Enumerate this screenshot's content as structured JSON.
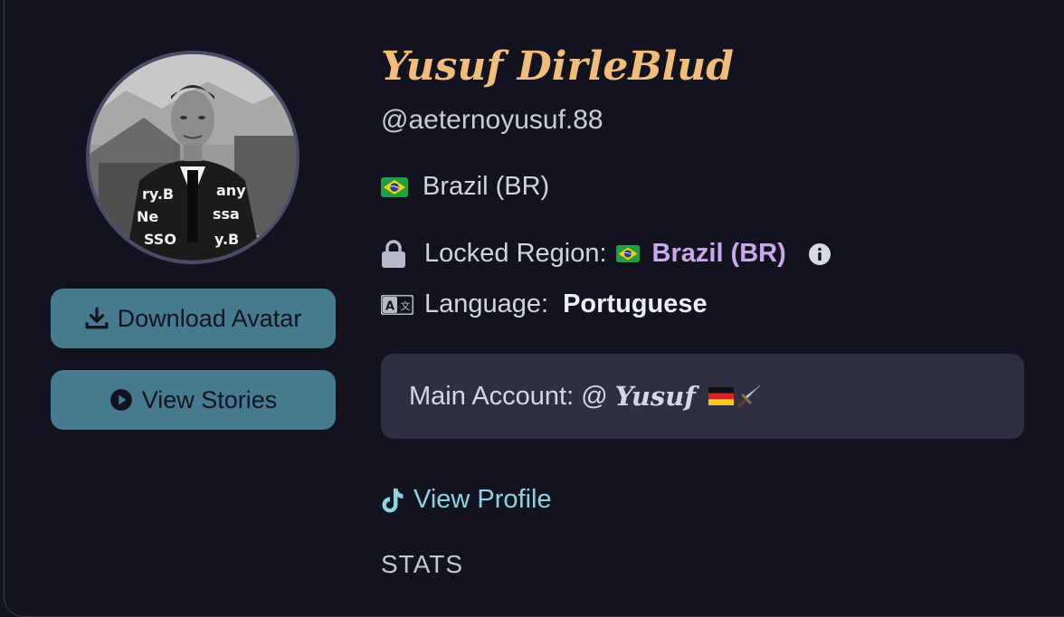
{
  "profile": {
    "display_name": "Yusuf DirleBlud",
    "handle": "@aeternoyusuf.88",
    "country": "Brazil (BR)",
    "locked_region_label": "Locked Region:",
    "locked_region_value": "Brazil (BR)",
    "language_label": "Language:",
    "language_value": "Portuguese",
    "main_account_label": "Main Account: @",
    "main_account_name": "Yusuf",
    "view_profile_label": "View Profile",
    "stats_label": "STATS"
  },
  "actions": {
    "download_avatar": "Download Avatar",
    "view_stories": "View Stories"
  },
  "icons": {
    "country_flag": "brazil-flag-icon",
    "locked": "lock-icon",
    "info": "info-icon",
    "language": "translate-icon",
    "main_account_emoji": [
      "germany-flag-icon",
      "dagger-icon"
    ],
    "profile_link": "tiktok-icon",
    "download": "download-icon",
    "stories": "play-circle-icon"
  },
  "colors": {
    "background": "#12131f",
    "name": "#f2bd78",
    "button": "#467a8e",
    "locked_region_value": "#c9a8ec",
    "link": "#8cd3e2",
    "panel": "#2f2f44"
  }
}
